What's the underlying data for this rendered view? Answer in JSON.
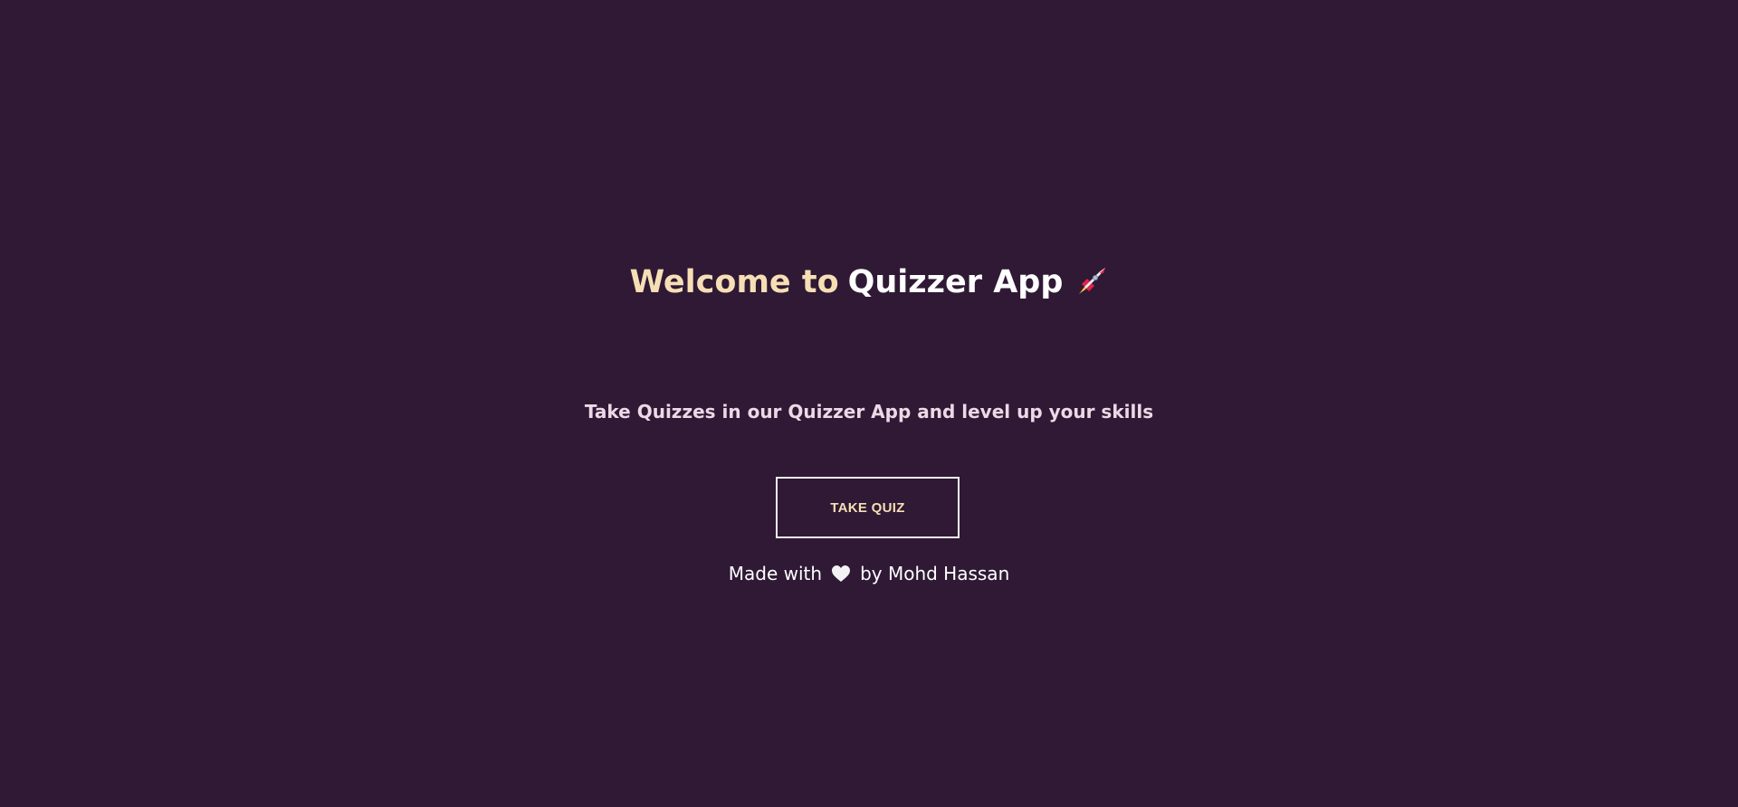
{
  "hero": {
    "title_prefix": "Welcome to",
    "title_brand": "Quizzer App",
    "title_icon": "rocket-icon"
  },
  "tagline": "Take Quizzes in our Quizzer App and level up your skills",
  "cta": {
    "label": "TAKE QUIZ"
  },
  "footer": {
    "made_with": "Made with",
    "heart_icon": "heart-icon",
    "by_author": "by Mohd Hassan"
  },
  "colors": {
    "background": "#2f1935",
    "accent": "#f6dfb4",
    "text": "#ffffff",
    "tagline": "#ecd9e6"
  }
}
